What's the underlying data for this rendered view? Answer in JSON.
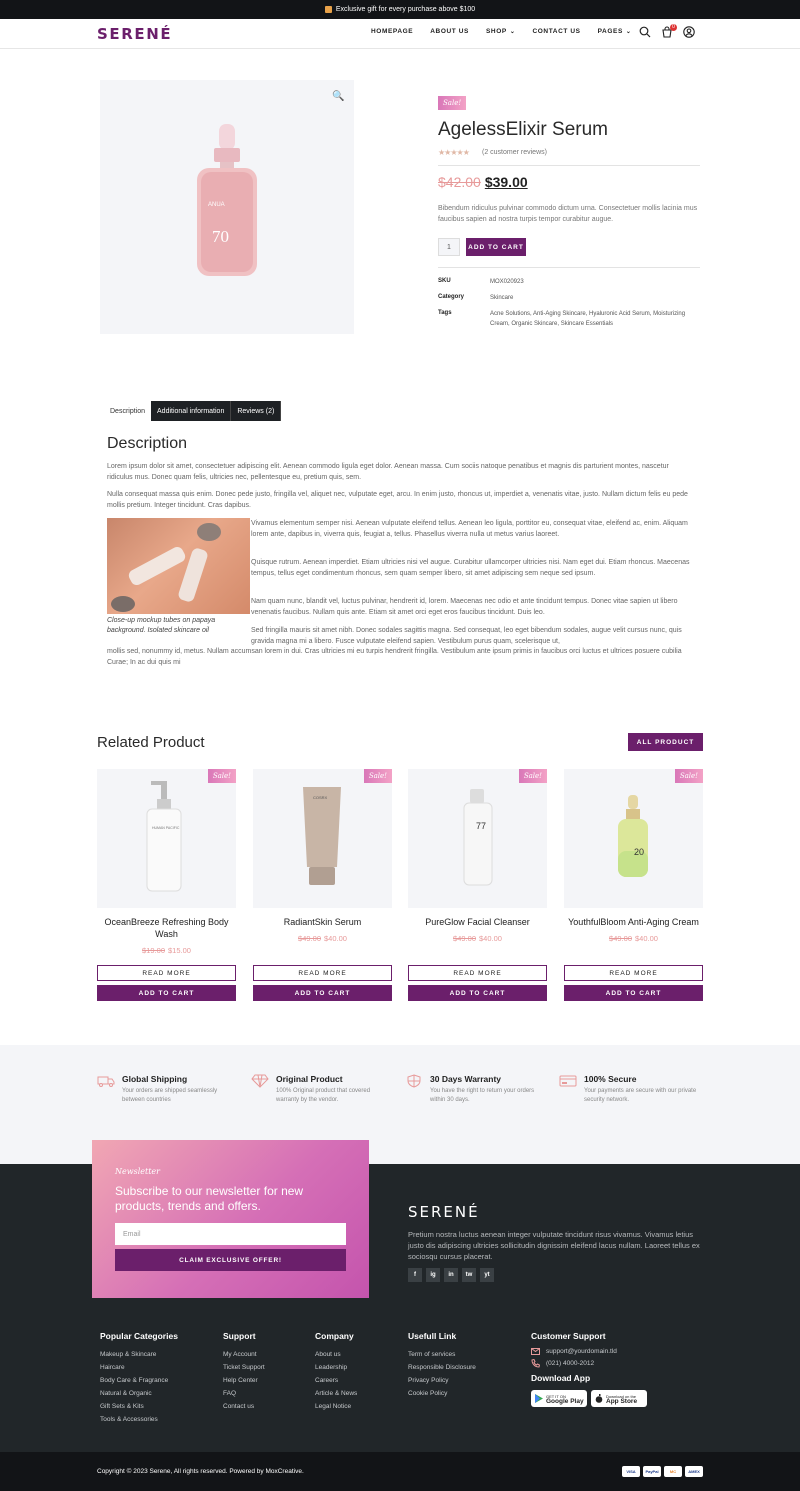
{
  "topbar": {
    "message": "Exclusive gift for every purchase above $100"
  },
  "header": {
    "logo": "SERENÉ",
    "nav": [
      {
        "label": "HOMEPAGE"
      },
      {
        "label": "ABOUT US"
      },
      {
        "label": "SHOP",
        "dropdown": true
      },
      {
        "label": "CONTACT US"
      },
      {
        "label": "PAGES",
        "dropdown": true
      }
    ],
    "cart_count": "0"
  },
  "product": {
    "sale_badge": "Sale!",
    "title": "AgelessElixir Serum",
    "rating_stars": "★★★★★",
    "reviews_text": "(2 customer reviews)",
    "old_price": "$42.00",
    "new_price": "$39.00",
    "short_description": "Bibendum ridiculus pulvinar commodo dictum urna. Consectetuer mollis lacinia mus faucibus sapien ad nostra turpis tempor curabitur augue.",
    "quantity": "1",
    "add_to_cart": "ADD TO CART",
    "meta": {
      "sku_label": "SKU",
      "sku": "MOX020923",
      "category_label": "Category",
      "category": "Skincare",
      "tags_label": "Tags",
      "tags": "Acne Solutions, Anti-Aging Skincare, Hyaluronic Acid Serum, Moisturizing Cream, Organic Skincare, Skincare Essentials"
    },
    "image_bottle_text": "ANUA",
    "image_bottle_number": "70"
  },
  "tabs": [
    {
      "label": "Description"
    },
    {
      "label": "Additional information"
    },
    {
      "label": "Reviews (2)"
    }
  ],
  "description": {
    "heading": "Description",
    "p1": "Lorem ipsum dolor sit amet, consectetuer adipiscing elit. Aenean commodo ligula eget dolor. Aenean massa. Cum sociis natoque penatibus et magnis dis parturient montes, nascetur ridiculus mus. Donec quam felis, ultricies nec, pellentesque eu, pretium quis, sem.",
    "p2": "Nulla consequat massa quis enim. Donec pede justo, fringilla vel, aliquet nec, vulputate eget, arcu. In enim justo, rhoncus ut, imperdiet a, venenatis vitae, justo. Nullam dictum felis eu pede mollis pretium. Integer tincidunt. Cras dapibus.",
    "p3": "Vivamus elementum semper nisi. Aenean vulputate eleifend tellus. Aenean leo ligula, porttitor eu, consequat vitae, eleifend ac, enim. Aliquam lorem ante, dapibus in, viverra quis, feugiat a, tellus. Phasellus viverra nulla ut metus varius laoreet.",
    "p4": "Quisque rutrum. Aenean imperdiet. Etiam ultricies nisi vel augue. Curabitur ullamcorper ultricies nisi. Nam eget dui. Etiam rhoncus. Maecenas tempus, tellus eget condimentum rhoncus, sem quam semper libero, sit amet adipiscing sem neque sed ipsum.",
    "p5": "Nam quam nunc, blandit vel, luctus pulvinar, hendrerit id, lorem. Maecenas nec odio et ante tincidunt tempus. Donec vitae sapien ut libero venenatis faucibus. Nullam quis ante. Etiam sit amet orci eget eros faucibus tincidunt. Duis leo.",
    "p6a": "Sed fringilla mauris sit amet nibh. Donec sodales sagittis magna. Sed consequat, leo eget bibendum sodales, augue velit cursus nunc, quis gravida magna mi a libero. Fusce vulputate eleifend sapien. Vestibulum purus quam, scelerisque ut,",
    "p6b": "mollis sed, nonummy id, metus. Nullam accumsan lorem in dui. Cras ultricies mi eu turpis hendrerit fringilla. Vestibulum ante ipsum primis in faucibus orci luctus et ultrices posuere cubilia Curae; In ac dui quis mi",
    "caption": "Close-up mockup tubes on papaya background. Isolated skincare oil"
  },
  "related": {
    "heading": "Related Product",
    "all_button": "ALL PRODUCT",
    "read_more": "READ MORE",
    "add_to_cart": "ADD TO CART",
    "sale_badge": "Sale!",
    "items": [
      {
        "name": "OceanBreeze Refreshing Body Wash",
        "old": "$19.00",
        "new": "$15.00",
        "label": "HUMAN PACIFIC"
      },
      {
        "name": "RadiantSkin Serum",
        "old": "$49.00",
        "new": "$40.00",
        "label": "COSRX"
      },
      {
        "name": "PureGlow Facial Cleanser",
        "old": "$49.00",
        "new": "$40.00",
        "label": "77"
      },
      {
        "name": "YouthfulBloom Anti-Aging Cream",
        "old": "$49.00",
        "new": "$40.00",
        "label": "20"
      }
    ]
  },
  "features": [
    {
      "title": "Global Shipping",
      "desc": "Your orders are shipped seamlessly between countries",
      "icon": "truck-icon"
    },
    {
      "title": "Original Product",
      "desc": "100% Original product that covered warranty by the vendor.",
      "icon": "diamond-icon"
    },
    {
      "title": "30 Days Warranty",
      "desc": "You have the right to return your orders within 30 days.",
      "icon": "shield-icon"
    },
    {
      "title": "100% Secure",
      "desc": "Your payments are secure with our private security network.",
      "icon": "card-icon"
    }
  ],
  "newsletter": {
    "eyebrow": "Newsletter",
    "title": "Subscribe to our newsletter for new products, trends and offers.",
    "email_placeholder": "Email",
    "button": "CLAIM EXCLUSIVE OFFER!"
  },
  "footer": {
    "logo": "SERENÉ",
    "description": "Pretium nostra luctus aenean integer vulputate tincidunt risus vivamus. Vivamus letius justo dis adipiscing ultricies sollicitudin dignissim eleifend lacus nullam. Laoreet tellus ex sociosqu cursus placerat.",
    "social": [
      "f",
      "ig",
      "in",
      "tw",
      "yt"
    ],
    "columns": [
      {
        "heading": "Popular Categories",
        "links": [
          "Makeup & Skincare",
          "Haircare",
          "Body Care & Fragrance",
          "Natural & Organic",
          "Gift Sets & Kits",
          "Tools & Accessories"
        ]
      },
      {
        "heading": "Support",
        "links": [
          "My Account",
          "Ticket Support",
          "Help Center",
          "FAQ",
          "Contact us"
        ]
      },
      {
        "heading": "Company",
        "links": [
          "About us",
          "Leadership",
          "Careers",
          "Article & News",
          "Legal Notice"
        ]
      },
      {
        "heading": "Usefull Link",
        "links": [
          "Term of services",
          "Responsible Disclosure",
          "Privacy Policy",
          "Cookie Policy"
        ]
      }
    ],
    "support": {
      "heading": "Customer Support",
      "email": "support@yourdomain.tld",
      "phone": "(021) 4000-2012",
      "app_heading": "Download App",
      "google_small": "GET IT ON",
      "google_big": "Google Play",
      "apple_small": "Download on the",
      "apple_big": "App Store"
    },
    "copyright": "Copyright © 2023 Serene, All rights reserved. Powered by MoxCreative.",
    "payments": [
      "VISA",
      "PayPal",
      "MC",
      "AMEX"
    ]
  },
  "colors": {
    "brand": "#6b1f6b",
    "sale_gradient_start": "#d977b8",
    "footer_bg": "#212629",
    "price_old": "#e79a9a"
  }
}
